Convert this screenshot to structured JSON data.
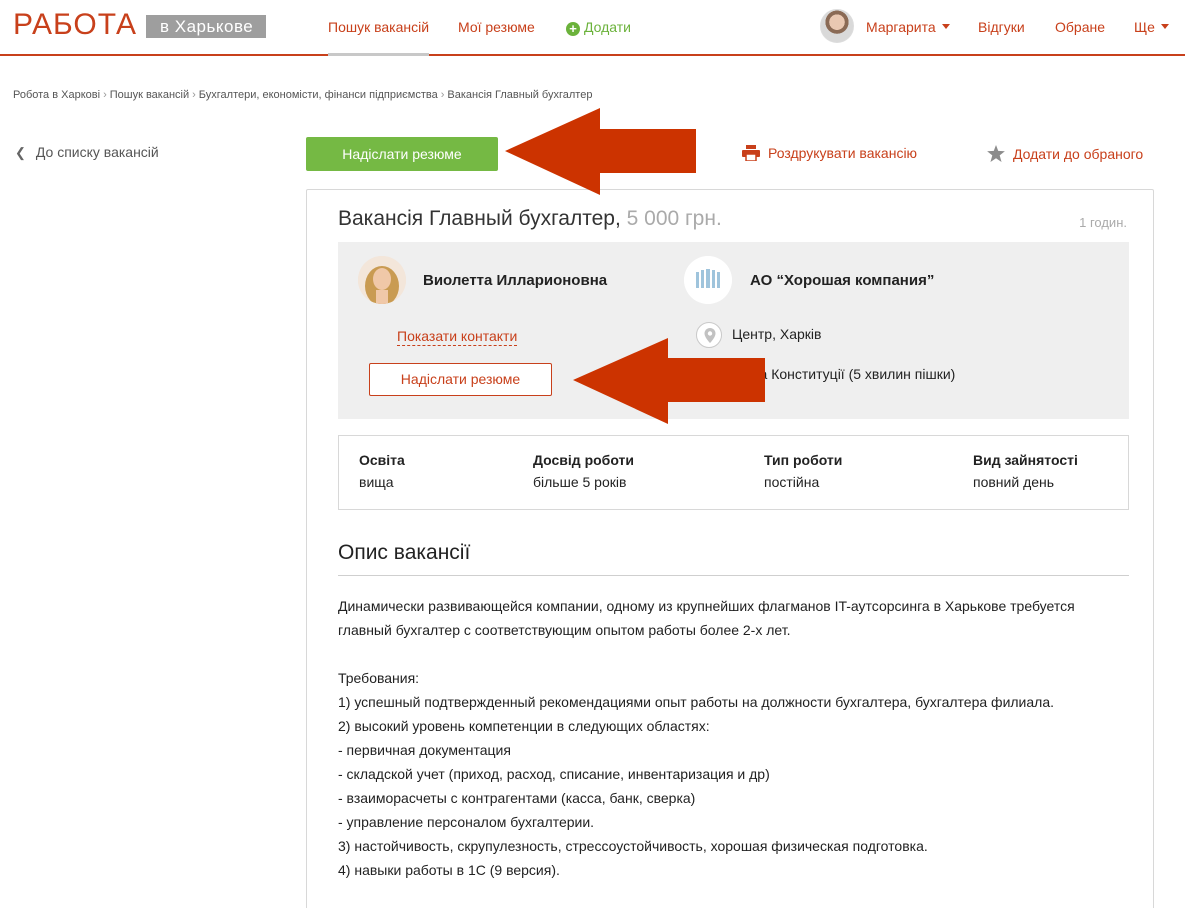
{
  "header": {
    "logo_text": "РАБОТА",
    "city": "в Харькове",
    "nav": {
      "search": "Пошук вакансій",
      "resumes": "Мої резюме",
      "add": "Додати"
    },
    "user_name": "Маргарита",
    "responses": "Відгуки",
    "favorites": "Обране",
    "more": "Ще"
  },
  "breadcrumb": [
    "Робота в Харкові",
    "Пошук вакансій",
    "Бухгалтери, економісти, фінанси підприємства",
    "Вакансія Главный бухгалтер"
  ],
  "back_label": "До списку вакансій",
  "actions": {
    "send_resume": "Надіслати резюме",
    "print": "Роздрукувати вакансію",
    "add_favorite": "Додати до обраного"
  },
  "vacancy": {
    "title": "Вакансія Главный бухгалтер,",
    "salary": "5 000 грн.",
    "posted": "1 годин.",
    "contact_name": "Виолетта Илларионовна",
    "show_contacts": "Показати контакти",
    "send_resume": "Надіслати резюме",
    "company": "АО “Хорошая компания”",
    "location": "Центр, Харків",
    "address": "ща Конституції (5 хвилин пішки)"
  },
  "properties": [
    {
      "key": "Освіта",
      "value": "вища"
    },
    {
      "key": "Досвід роботи",
      "value": "більше 5 років"
    },
    {
      "key": "Тип роботи",
      "value": "постійна"
    },
    {
      "key": "Вид зайнятості",
      "value": "повний день"
    }
  ],
  "description": {
    "title": "Опис вакансії",
    "lines": [
      "Динамически развивающейся компании, одному из крупнейших флагманов IT-аутсорсинга в Харькове требуется",
      "главный бухгалтер с соответствующим опытом работы более 2-х лет.",
      "",
      "Требования:",
      "1) успешный подтвержденный рекомендациями опыт работы на должности бухгалтера, бухгалтера филиала.",
      "2) высокий уровень компетенции в следующих областях:",
      "- первичная документация",
      "- складской учет (приход, расход, списание, инвентаризация и др)",
      "- взаиморасчеты с контрагентами (касса, банк, сверка)",
      "- управление персоналом бухгалтерии.",
      "3) настойчивость, скрупулезность, стрессоустойчивость, хорошая физическая подготовка.",
      "4) навыки работы в 1С (9 версия)."
    ]
  },
  "colors": {
    "brand": "#c8401b",
    "green": "#75b944",
    "arrow": "#cc3300"
  }
}
